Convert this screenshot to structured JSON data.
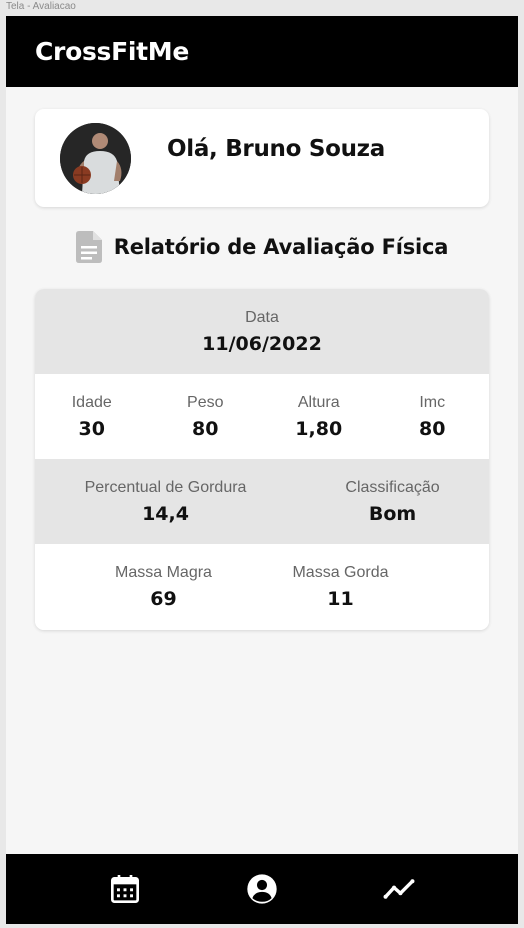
{
  "frame": {
    "label": "Tela - Avaliacao"
  },
  "app": {
    "title": "CrossFitMe"
  },
  "profile": {
    "greeting": "Olá, Bruno Souza"
  },
  "report": {
    "title": "Relatório de Avaliação Física",
    "date": {
      "label": "Data",
      "value": "11/06/2022"
    },
    "metrics": [
      {
        "label": "Idade",
        "value": "30"
      },
      {
        "label": "Peso",
        "value": "80"
      },
      {
        "label": "Altura",
        "value": "1,80"
      },
      {
        "label": "Imc",
        "value": "80"
      }
    ],
    "body_fat": {
      "label": "Percentual de Gordura",
      "value": "14,4"
    },
    "classification": {
      "label": "Classificação",
      "value": "Bom"
    },
    "lean_mass": {
      "label": "Massa Magra",
      "value": "69"
    },
    "fat_mass": {
      "label": "Massa Gorda",
      "value": "11"
    }
  },
  "nav": {
    "items": [
      {
        "icon": "calendar-icon"
      },
      {
        "icon": "account-circle-icon"
      },
      {
        "icon": "trending-chart-icon"
      }
    ]
  },
  "colors": {
    "appbar": "#000000",
    "background": "#f6f6f6",
    "band_gray": "#e5e5e5"
  }
}
